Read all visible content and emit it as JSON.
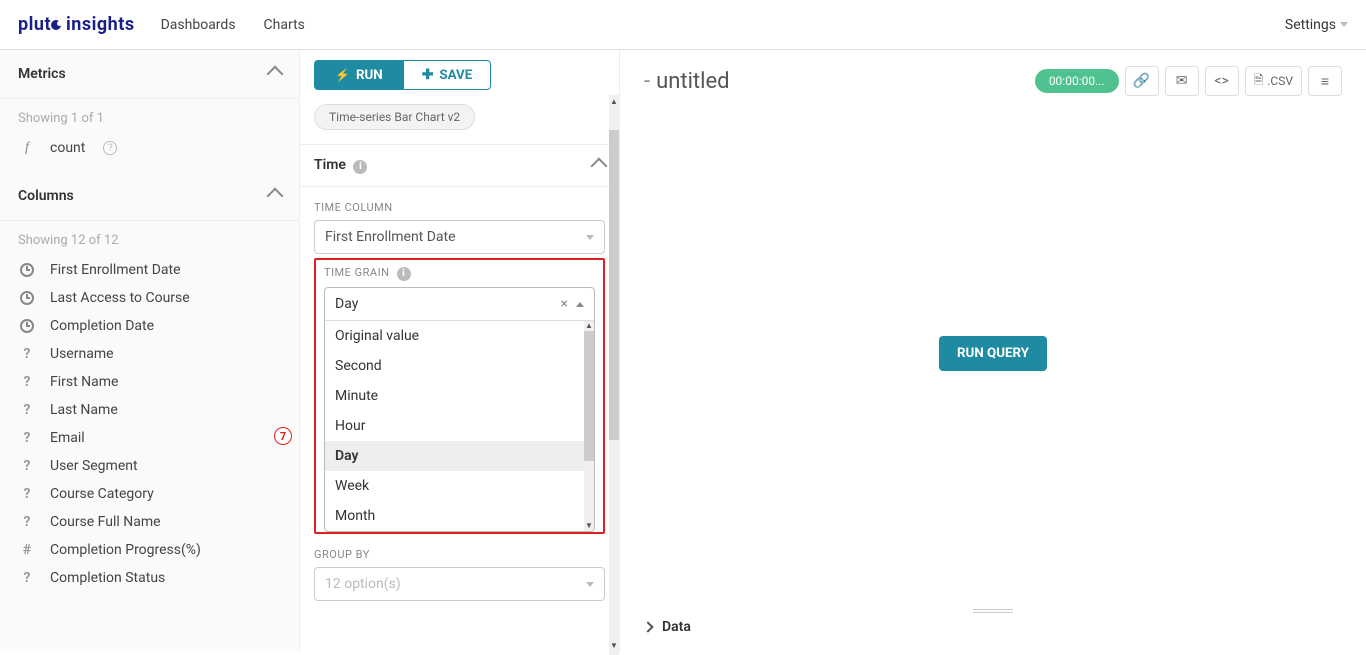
{
  "topnav": {
    "logo_part1": "plut",
    "logo_part2": " insights",
    "links": [
      "Dashboards",
      "Charts"
    ],
    "settings": "Settings"
  },
  "left": {
    "metrics_title": "Metrics",
    "metrics_showing": "Showing 1 of 1",
    "metric_items": [
      "count"
    ],
    "columns_title": "Columns",
    "columns_showing": "Showing 12 of 12",
    "columns": [
      {
        "icon": "clock",
        "label": "First Enrollment Date"
      },
      {
        "icon": "clock",
        "label": "Last Access to Course"
      },
      {
        "icon": "clock",
        "label": "Completion Date"
      },
      {
        "icon": "q",
        "label": "Username"
      },
      {
        "icon": "q",
        "label": "First Name"
      },
      {
        "icon": "q",
        "label": "Last Name"
      },
      {
        "icon": "q",
        "label": "Email"
      },
      {
        "icon": "q",
        "label": "User Segment"
      },
      {
        "icon": "q",
        "label": "Course Category"
      },
      {
        "icon": "q",
        "label": "Course Full Name"
      },
      {
        "icon": "hash",
        "label": "Completion Progress(%)"
      },
      {
        "icon": "q",
        "label": "Completion Status"
      }
    ]
  },
  "mid": {
    "run": "RUN",
    "save": "SAVE",
    "chart_type_chip": "Time-series Bar Chart v2",
    "time_section": "Time",
    "time_column_label": "TIME COLUMN",
    "time_column_value": "First Enrollment Date",
    "time_grain_label": "TIME GRAIN",
    "time_grain_value": "Day",
    "time_grain_options": [
      "Original value",
      "Second",
      "Minute",
      "Hour",
      "Day",
      "Week",
      "Month"
    ],
    "group_by_label": "GROUP BY",
    "group_by_placeholder": "12 option(s)"
  },
  "right": {
    "title": "untitled",
    "timer": "00:00:00...",
    "csv": ".CSV",
    "run_query": "RUN QUERY",
    "data_label": "Data"
  },
  "annotation": "7"
}
